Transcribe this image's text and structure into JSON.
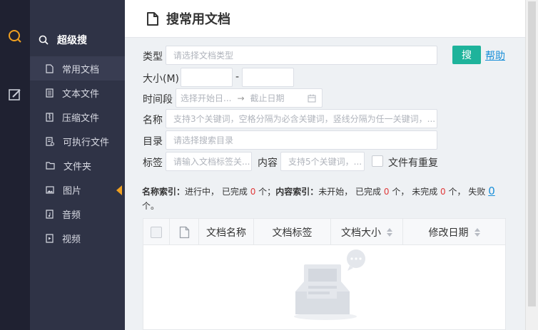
{
  "nav": {
    "header_label": "超级搜",
    "items": [
      {
        "label": "常用文档",
        "icon": "document-icon"
      },
      {
        "label": "文本文件",
        "icon": "text-file-icon"
      },
      {
        "label": "压缩文件",
        "icon": "zip-file-icon"
      },
      {
        "label": "可执行文件",
        "icon": "executable-file-icon"
      },
      {
        "label": "文件夹",
        "icon": "folder-icon"
      },
      {
        "label": "图片",
        "icon": "image-icon"
      },
      {
        "label": "音频",
        "icon": "audio-icon"
      },
      {
        "label": "视频",
        "icon": "video-icon"
      }
    ]
  },
  "page": {
    "title": "搜常用文档"
  },
  "form": {
    "type_label": "类型",
    "type_placeholder": "请选择文档类型",
    "size_label": "大小(M)",
    "size_dash": "-",
    "time_label": "时间段",
    "time_start_placeholder": "选择开始日...",
    "time_arrow": "→",
    "time_end_placeholder": "截止日期",
    "name_label": "名称",
    "name_placeholder": "支持3个关键词，空格分隔为必含关键词，竖线分隔为任一关键词，...",
    "dir_label": "目录",
    "dir_placeholder": "请选择搜索目录",
    "tag_label": "标签",
    "tag_placeholder": "请输入文档标签关...",
    "content_label": "内容",
    "content_placeholder": "支持5个关键词，...",
    "duplicate_label": "文件有重复",
    "search_button": "搜",
    "help_link": "帮助"
  },
  "index_status": {
    "name_index_label": "名称索引：",
    "name_index_state": "进行中，",
    "name_done_prefix": "已完成",
    "name_done_count": "0",
    "name_done_suffix": "个；",
    "content_index_label": "内容索引：",
    "content_state": "未开始，",
    "content_done_prefix": "已完成",
    "content_done_count": "0",
    "content_done_suffix": "个，",
    "pending_prefix": "未完成",
    "pending_count": "0",
    "pending_suffix": "个，",
    "failed_prefix": "失败",
    "failed_count": "0",
    "failed_suffix": "个。"
  },
  "table": {
    "columns": [
      "文档名称",
      "文档标签",
      "文档大小",
      "修改日期"
    ]
  },
  "colors": {
    "accent": "#1eb39b",
    "link": "#1a8fd8",
    "rail_bg": "#1f2131",
    "nav_bg": "#2f3346",
    "arrow": "#f0a020",
    "count_red": "#e03a3a"
  }
}
